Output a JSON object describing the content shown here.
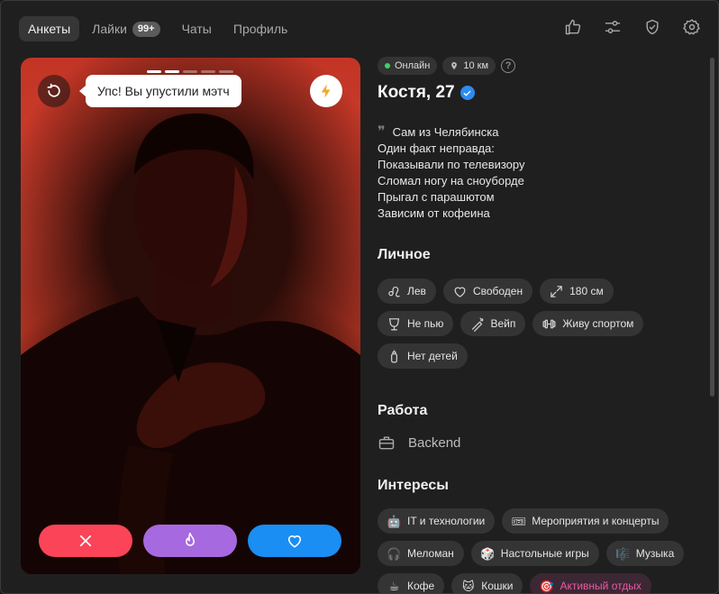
{
  "nav": {
    "tabs": [
      {
        "label": "Анкеты",
        "active": true
      },
      {
        "label": "Лайки",
        "badge": "99+"
      },
      {
        "label": "Чаты"
      },
      {
        "label": "Профиль"
      }
    ],
    "icons": [
      "thumbs-up-icon",
      "sliders-icon",
      "shield-check-icon",
      "gear-icon"
    ]
  },
  "photo": {
    "progress": {
      "total": 5,
      "current": 2
    },
    "tooltip": "Упс! Вы упустили мэтч",
    "actions": [
      "dislike",
      "super-like",
      "like"
    ]
  },
  "profile": {
    "status": "Онлайн",
    "distance": "10 км",
    "help": "?",
    "name": "Костя, 27",
    "verified": true,
    "bio": [
      "Сам из Челябинска",
      "Один факт неправда:",
      "Показывали по телевизору",
      "Сломал ногу на сноуборде",
      "Прыгал с парашютом",
      "Зависим от кофеина"
    ]
  },
  "personal": {
    "title": "Личное",
    "items": [
      {
        "label": "Лев",
        "icon": "leo-icon"
      },
      {
        "label": "Свободен",
        "icon": "heart-outline-icon"
      },
      {
        "label": "180 см",
        "icon": "expand-icon"
      },
      {
        "label": "Не пью",
        "icon": "glass-icon"
      },
      {
        "label": "Вейп",
        "icon": "vape-icon"
      },
      {
        "label": "Живу спортом",
        "icon": "dumbbell-icon"
      },
      {
        "label": "Нет детей",
        "icon": "bottle-icon"
      }
    ]
  },
  "work": {
    "title": "Работа",
    "value": "Backend"
  },
  "interests": {
    "title": "Интересы",
    "items": [
      {
        "label": "IT и технологии",
        "emoji": "🤖"
      },
      {
        "label": "Мероприятия и концерты",
        "emoji": "🎟"
      },
      {
        "label": "Меломан",
        "emoji": "🎧"
      },
      {
        "label": "Настольные игры",
        "emoji": "🎲"
      },
      {
        "label": "Музыка",
        "emoji": "🎼"
      },
      {
        "label": "Кофе",
        "emoji": "☕"
      },
      {
        "label": "Кошки",
        "emoji": "🐱"
      },
      {
        "label": "Активный отдых",
        "emoji": "🎯",
        "highlight": true
      }
    ]
  },
  "colors": {
    "dislike": "#fb4458",
    "super": "#a769e0",
    "like": "#1a8ef3",
    "online": "#3fd168",
    "verified": "#2d8cf0",
    "boost": "#f5a623"
  }
}
